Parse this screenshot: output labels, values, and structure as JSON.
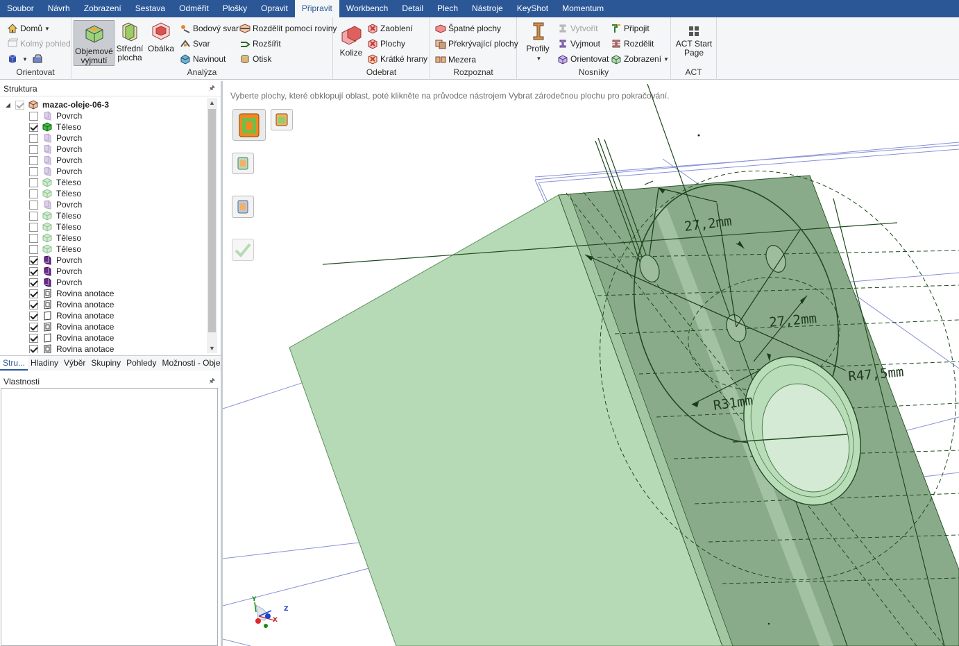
{
  "menu": {
    "tabs": [
      "Soubor",
      "Návrh",
      "Zobrazení",
      "Sestava",
      "Odměřit",
      "Plošky",
      "Opravit",
      "Připravit",
      "Workbench",
      "Detail",
      "Plech",
      "Nástroje",
      "KeyShot",
      "Momentum"
    ],
    "active": "Připravit"
  },
  "ribbon": {
    "orientovat": {
      "label": "Orientovat",
      "home": "Domů",
      "kolmy": "Kolmý pohled"
    },
    "analyza": {
      "label": "Analýza",
      "objemove": [
        "Objemové",
        "vyjmutí"
      ],
      "stredni": [
        "Střední",
        "plocha"
      ],
      "obalka": "Obálka",
      "bodovy_svar": "Bodový svar",
      "svar": "Svar",
      "navinout": "Navinout",
      "rozdelit_roviny": "Rozdělit pomocí roviny",
      "rozsirit": "Rozšířit",
      "otisk": "Otisk"
    },
    "odebrat": {
      "label": "Odebrat",
      "kolize": "Kolize",
      "zaobleni": "Zaoblení",
      "plochy": "Plochy",
      "kratke_hrany": "Krátké hrany"
    },
    "rozpoznat": {
      "label": "Rozpoznat",
      "spatne_plochy": "Špatné plochy",
      "prekryvajici": "Překrývající plochy",
      "mezera": "Mezera"
    },
    "nosniky": {
      "label": "Nosníky",
      "profily": "Profily",
      "vytvorit": "Vytvořit",
      "vyjmout": "Vyjmout",
      "orientovat": "Orientovat",
      "pripojit": "Připojit",
      "rozdelit": "Rozdělit",
      "zobrazeni": "Zobrazení"
    },
    "act": {
      "label": "ACT",
      "start_page": [
        "ACT Start",
        "Page"
      ]
    }
  },
  "structure": {
    "title": "Struktura",
    "root": "mazac-oleje-06-3",
    "items": [
      {
        "label": "Povrch",
        "checked": false,
        "kind": "surface-light"
      },
      {
        "label": "Těleso",
        "checked": true,
        "kind": "solid-green"
      },
      {
        "label": "Povrch",
        "checked": false,
        "kind": "surface-light"
      },
      {
        "label": "Povrch",
        "checked": false,
        "kind": "surface-light"
      },
      {
        "label": "Povrch",
        "checked": false,
        "kind": "surface-light"
      },
      {
        "label": "Povrch",
        "checked": false,
        "kind": "surface-light"
      },
      {
        "label": "Těleso",
        "checked": false,
        "kind": "solid-light"
      },
      {
        "label": "Těleso",
        "checked": false,
        "kind": "solid-light"
      },
      {
        "label": "Povrch",
        "checked": false,
        "kind": "surface-light"
      },
      {
        "label": "Těleso",
        "checked": false,
        "kind": "solid-light"
      },
      {
        "label": "Těleso",
        "checked": false,
        "kind": "solid-light"
      },
      {
        "label": "Těleso",
        "checked": false,
        "kind": "solid-light"
      },
      {
        "label": "Těleso",
        "checked": false,
        "kind": "solid-light"
      },
      {
        "label": "Povrch",
        "checked": true,
        "kind": "surface-dark"
      },
      {
        "label": "Povrch",
        "checked": true,
        "kind": "surface-dark"
      },
      {
        "label": "Povrch",
        "checked": true,
        "kind": "surface-dark"
      },
      {
        "label": "Rovina anotace",
        "checked": true,
        "kind": "plane-filled"
      },
      {
        "label": "Rovina anotace",
        "checked": true,
        "kind": "plane-filled"
      },
      {
        "label": "Rovina anotace",
        "checked": true,
        "kind": "plane-empty"
      },
      {
        "label": "Rovina anotace",
        "checked": true,
        "kind": "plane-filled"
      },
      {
        "label": "Rovina anotace",
        "checked": true,
        "kind": "plane-empty"
      },
      {
        "label": "Rovina anotace",
        "checked": true,
        "kind": "plane-filled"
      }
    ],
    "tabs": [
      "Stru...",
      "Hladiny",
      "Výběr",
      "Skupiny",
      "Pohledy",
      "Možnosti - Obje..."
    ]
  },
  "properties": {
    "title": "Vlastnosti"
  },
  "viewport": {
    "hint": "Vyberte plochy, které obklopují oblast, poté klikněte na průvodce nástrojem Vybrat zárodečnou plochu pro pokračování.",
    "dimensions": [
      "27,2mm",
      "27,2mm",
      "R47,5mm",
      "R31mm"
    ],
    "axes": {
      "y": "Y",
      "z": "Z",
      "x": "X"
    },
    "colors": {
      "body_front": "#b6dab6",
      "body_side": "#8aab8a",
      "edge": "#1e5a1e",
      "plane": "#8890d8"
    }
  }
}
